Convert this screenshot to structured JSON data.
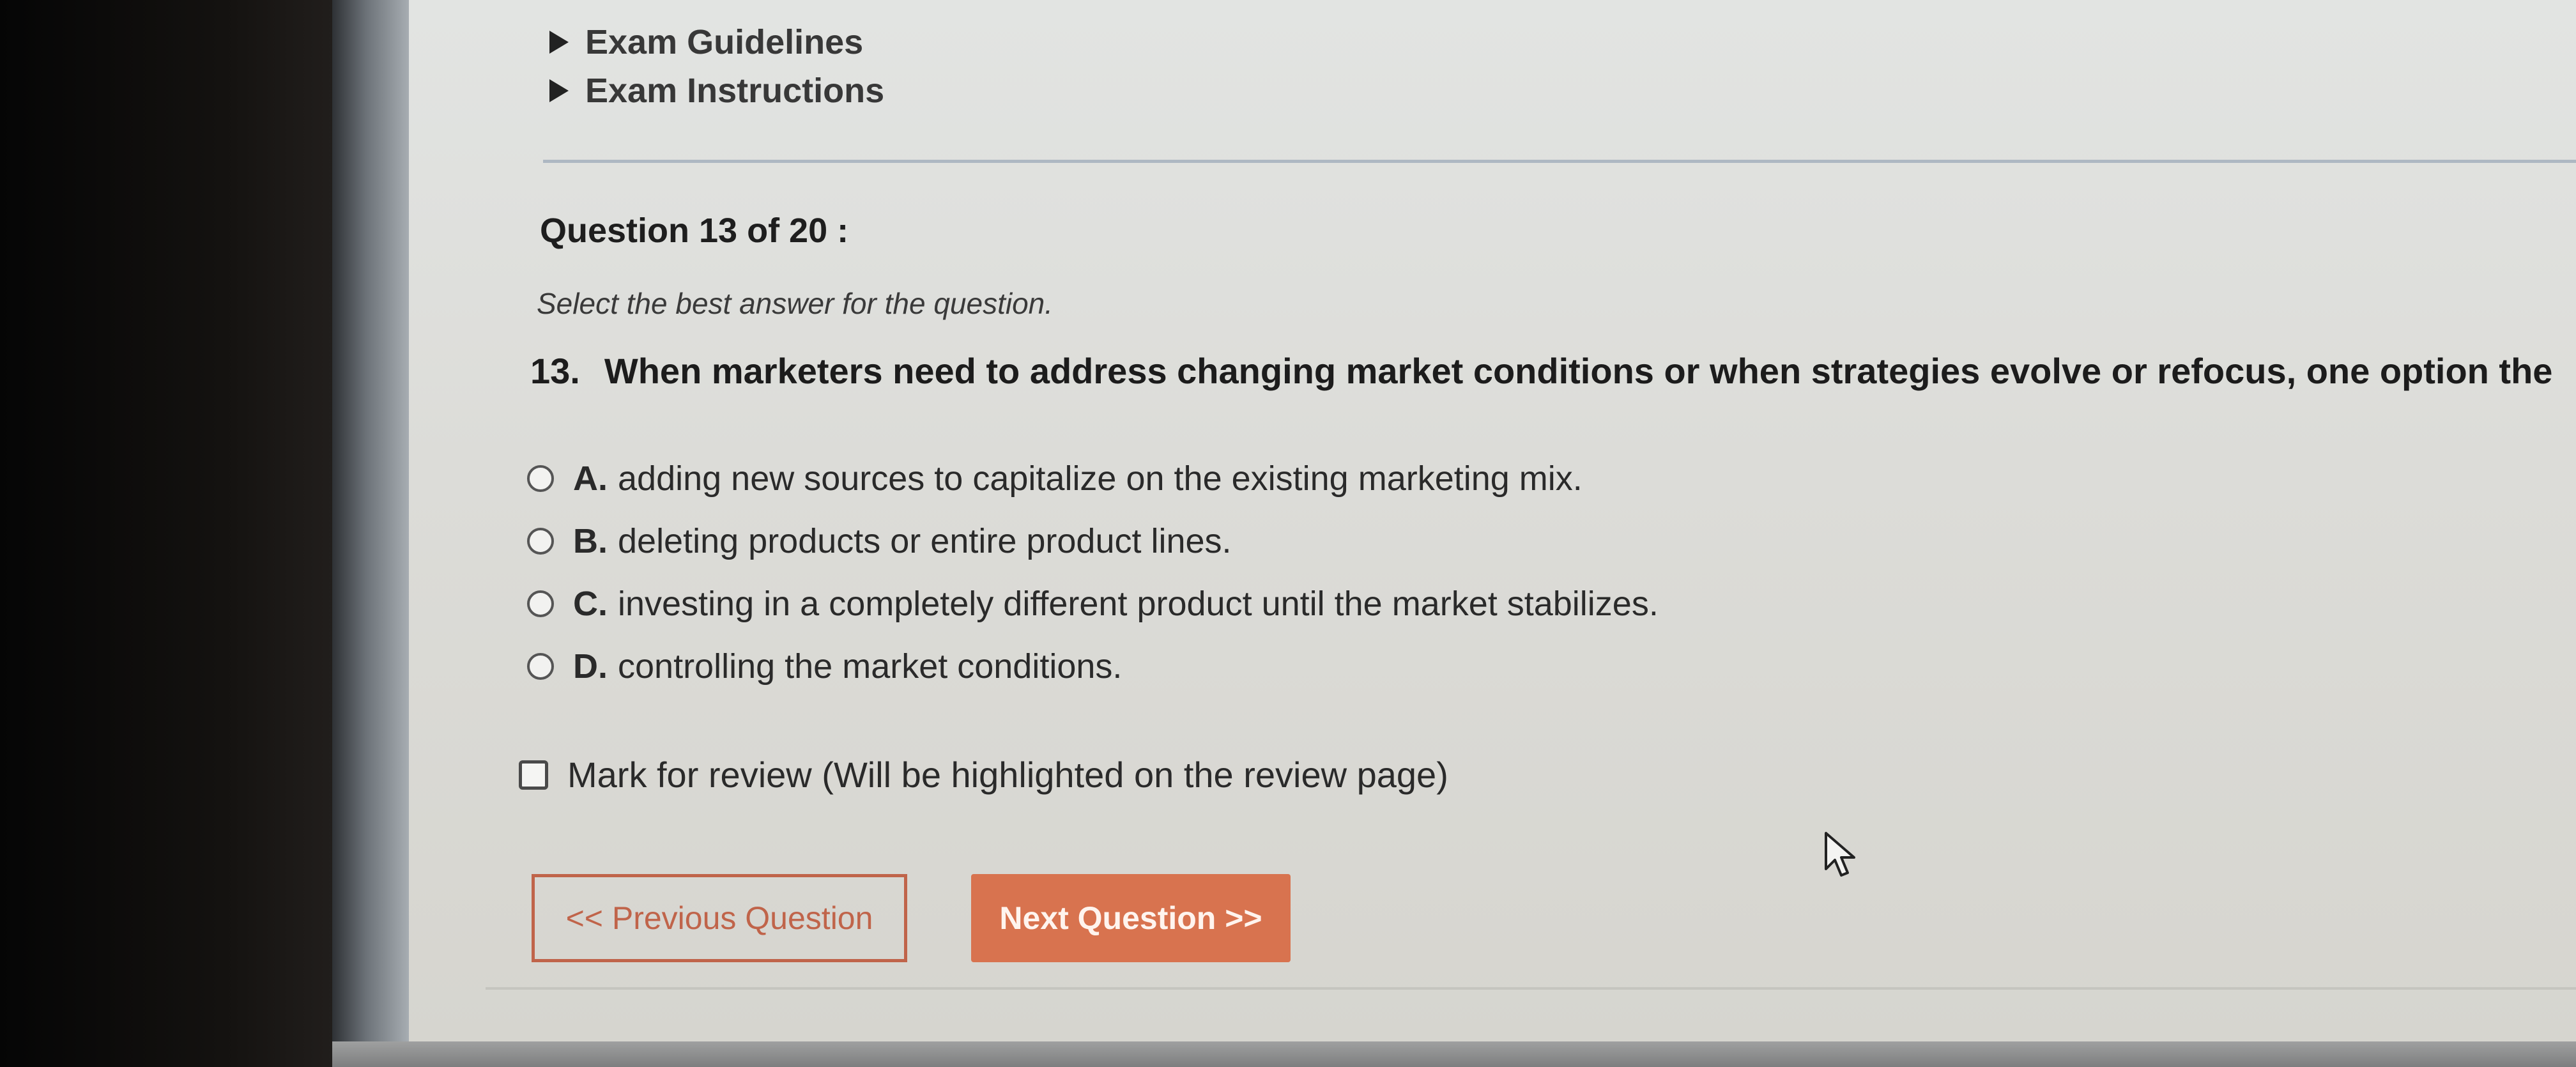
{
  "nav": {
    "exam_guidelines": "Exam Guidelines",
    "exam_instructions": "Exam Instructions"
  },
  "question_header": "Question 13 of 20 :",
  "instruction": "Select the best answer for the question.",
  "question": {
    "number": "13.",
    "text": "When marketers need to address changing market conditions or when strategies evolve or refocus, one option the"
  },
  "options": [
    {
      "letter": "A.",
      "text": "adding new sources to capitalize on the existing marketing mix."
    },
    {
      "letter": "B.",
      "text": "deleting products or entire product lines."
    },
    {
      "letter": "C.",
      "text": "investing in a completely different product until the market stabilizes."
    },
    {
      "letter": "D.",
      "text": "controlling the market conditions."
    }
  ],
  "review_label": "Mark for review (Will be highlighted on the review page)",
  "buttons": {
    "previous": "<< Previous Question",
    "next": "Next Question >>"
  },
  "colors": {
    "accent": "#d8734f",
    "accent_border": "#c0644a"
  }
}
